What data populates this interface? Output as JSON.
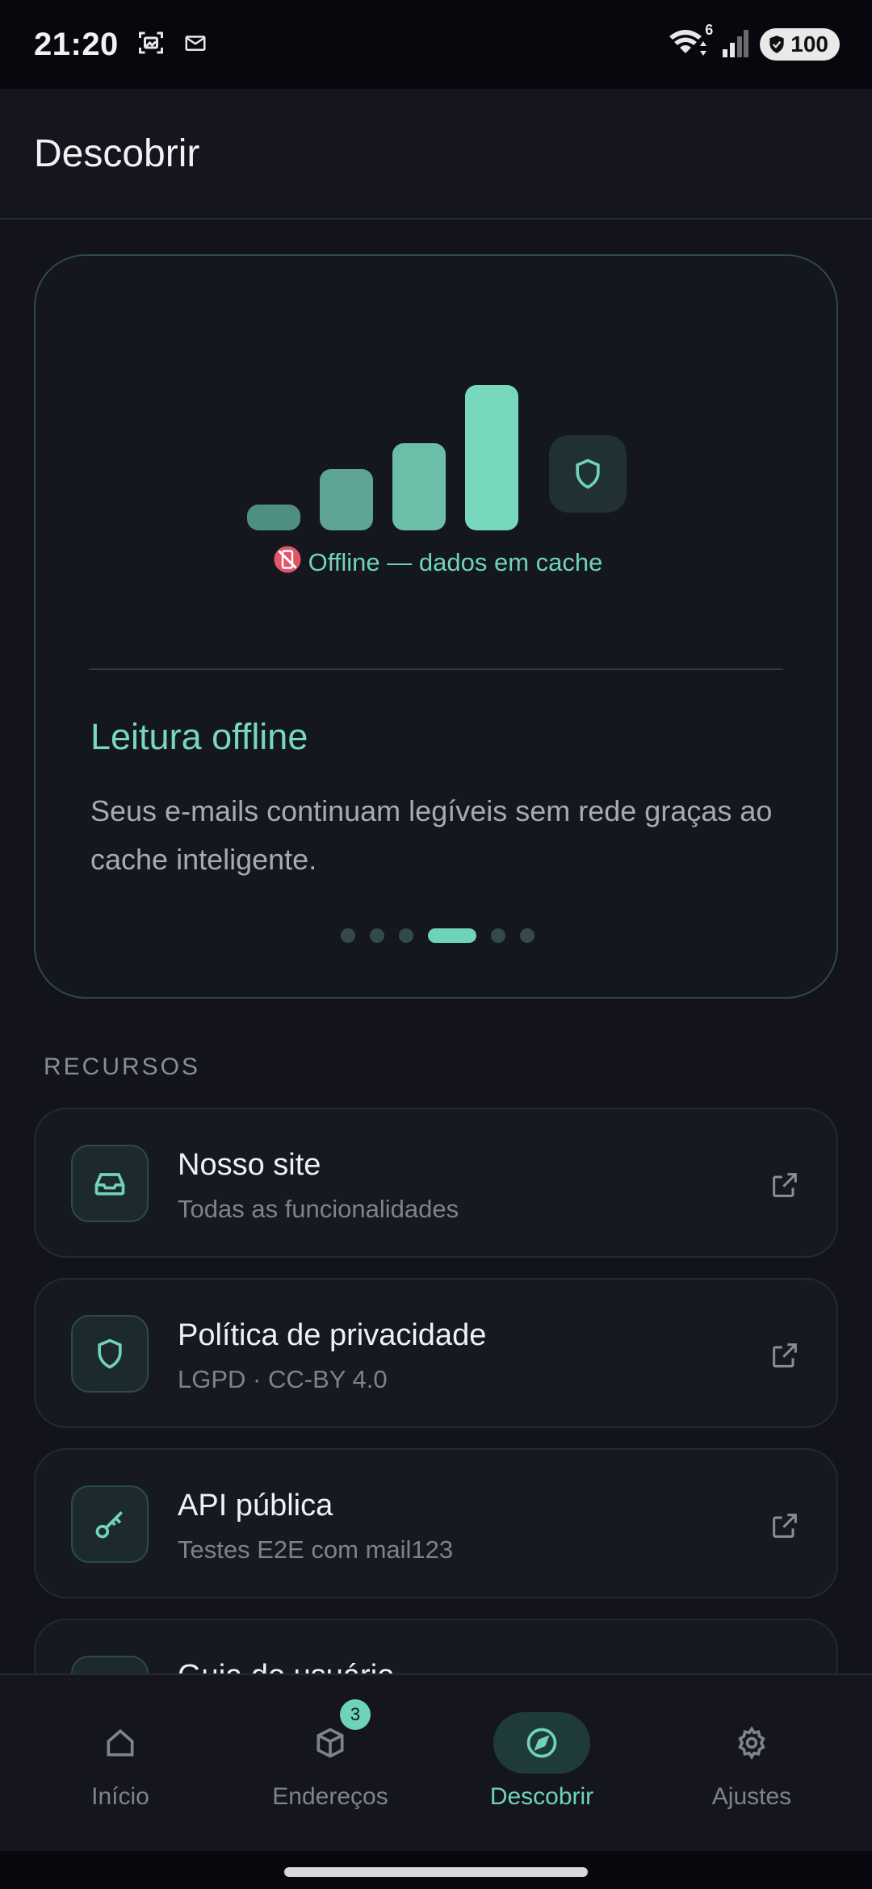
{
  "status_bar": {
    "time": "21:20",
    "wifi_badge": "6",
    "battery": "100"
  },
  "header": {
    "title": "Descobrir"
  },
  "hero": {
    "status_text": "Offline — dados em cache",
    "title": "Leitura offline",
    "description": "Seus e-mails continuam legíveis sem rede graças ao cache inteligente.",
    "pager": {
      "total": 6,
      "active": 4
    },
    "accent_color": "#6fd3b9"
  },
  "resources": {
    "section_label": "RECURSOS",
    "items": [
      {
        "title": "Nosso site",
        "subtitle": "Todas as funcionalidades",
        "icon": "inbox-icon"
      },
      {
        "title": "Política de privacidade",
        "subtitle": "LGPD · CC-BY 4.0",
        "icon": "shield-icon"
      },
      {
        "title": "API pública",
        "subtitle": "Testes E2E com mail123",
        "icon": "key-icon"
      },
      {
        "title": "Guia do usuário",
        "subtitle": "",
        "icon": "book-icon"
      }
    ]
  },
  "bottom_nav": {
    "items": [
      {
        "label": "Início",
        "icon": "home-icon"
      },
      {
        "label": "Endereços",
        "icon": "box-icon",
        "badge": "3"
      },
      {
        "label": "Descobrir",
        "icon": "compass-icon",
        "active": true
      },
      {
        "label": "Ajustes",
        "icon": "gear-icon"
      }
    ]
  }
}
